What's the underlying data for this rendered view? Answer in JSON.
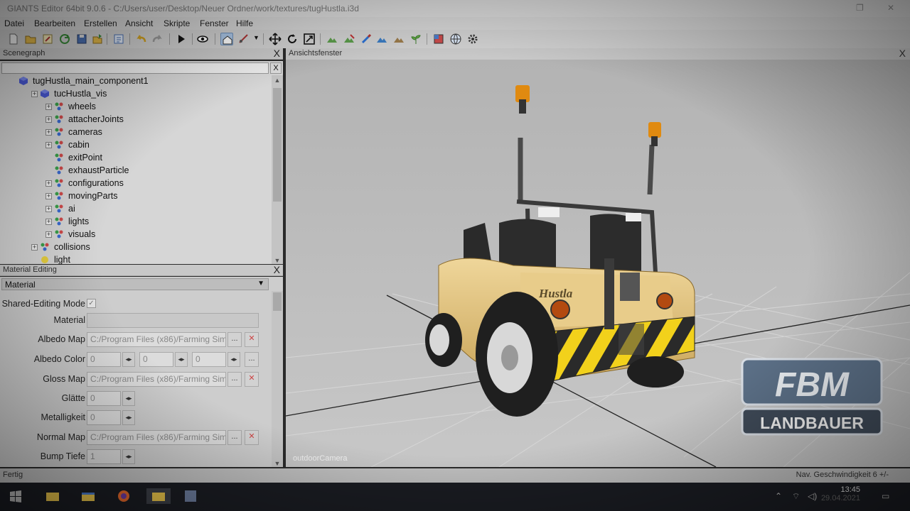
{
  "window": {
    "title": "GIANTS Editor 64bit 9.0.6 - C:/Users/user/Desktop/Neuer Ordner/work/textures/tugHustla.i3d"
  },
  "menu": [
    "Datei",
    "Bearbeiten",
    "Erstellen",
    "Ansicht",
    "Skripte",
    "Fenster",
    "Hilfe"
  ],
  "toolbar": {
    "icons": [
      "new-icon",
      "open-icon",
      "edit-icon",
      "refresh-icon",
      "save-icon",
      "export-icon",
      "script-icon",
      "undo-icon",
      "redo-icon",
      "play-icon",
      "eye-icon",
      "home-icon",
      "snap-icon",
      "move-icon",
      "rotate-icon",
      "scale-icon",
      "paint-terrain-icon",
      "paint-foliage-icon",
      "brush-icon",
      "paint-color-icon",
      "paint-texture-icon",
      "plant-icon",
      "material-icon",
      "globe-icon",
      "settings-icon"
    ]
  },
  "scenegraph": {
    "title": "Scenegraph",
    "close": "X",
    "filter_placeholder": "",
    "clear": "X",
    "nodes": [
      {
        "label": "tugHustla_main_component1",
        "type": "shape"
      },
      {
        "label": "tucHustla_vis",
        "type": "shape"
      },
      {
        "label": "wheels",
        "type": "transform"
      },
      {
        "label": "attacherJoints",
        "type": "transform"
      },
      {
        "label": "cameras",
        "type": "transform"
      },
      {
        "label": "cabin",
        "type": "transform"
      },
      {
        "label": "exitPoint",
        "type": "transform"
      },
      {
        "label": "exhaustParticle",
        "type": "transform"
      },
      {
        "label": "configurations",
        "type": "transform"
      },
      {
        "label": "movingParts",
        "type": "transform"
      },
      {
        "label": "ai",
        "type": "transform"
      },
      {
        "label": "lights",
        "type": "transform"
      },
      {
        "label": "visuals",
        "type": "transform"
      },
      {
        "label": "collisions",
        "type": "transform"
      },
      {
        "label": "light",
        "type": "light"
      }
    ]
  },
  "material_editing": {
    "title": "Material Editing",
    "close": "X",
    "dropdown_value": "Material",
    "shared_mode_label": "Shared-Editing Mode",
    "rows": {
      "material_label": "Material",
      "albedo_map_label": "Albedo Map",
      "albedo_map_value": "C:/Program Files (x86)/Farming Sim",
      "albedo_color_label": "Albedo Color",
      "albedo_color_values": [
        "0",
        "0",
        "0"
      ],
      "gloss_map_label": "Gloss Map",
      "gloss_map_value": "C:/Program Files (x86)/Farming Sim",
      "glaette_label": "Glätte",
      "glaette_value": "0",
      "metallic_label": "Metalligkeit",
      "metallic_value": "0",
      "normal_map_label": "Normal Map",
      "normal_map_value": "C:/Program Files (x86)/Farming Sim",
      "bump_label": "Bump Tiefe",
      "bump_value": "1",
      "browse": "...",
      "clear": "✕"
    }
  },
  "viewport": {
    "title": "Ansichtsfenster",
    "close": "X",
    "camera": "outdoorCamera",
    "vehicle_badge": "Hustla",
    "watermark_top": "FBM",
    "watermark_bottom": "LANDBAUER"
  },
  "status": {
    "left": "Fertig",
    "right": "Nav. Geschwindigkeit 6 +/-"
  },
  "taskbar": {
    "time": "13:45",
    "date": "29.04.2021"
  },
  "colors": {
    "vehicle_body": "#e3c27a",
    "hazard_yellow": "#f2d11b",
    "hazard_black": "#2a2a2a",
    "beacon": "#e08a10",
    "viewport_bg": "#b6b6b6"
  }
}
